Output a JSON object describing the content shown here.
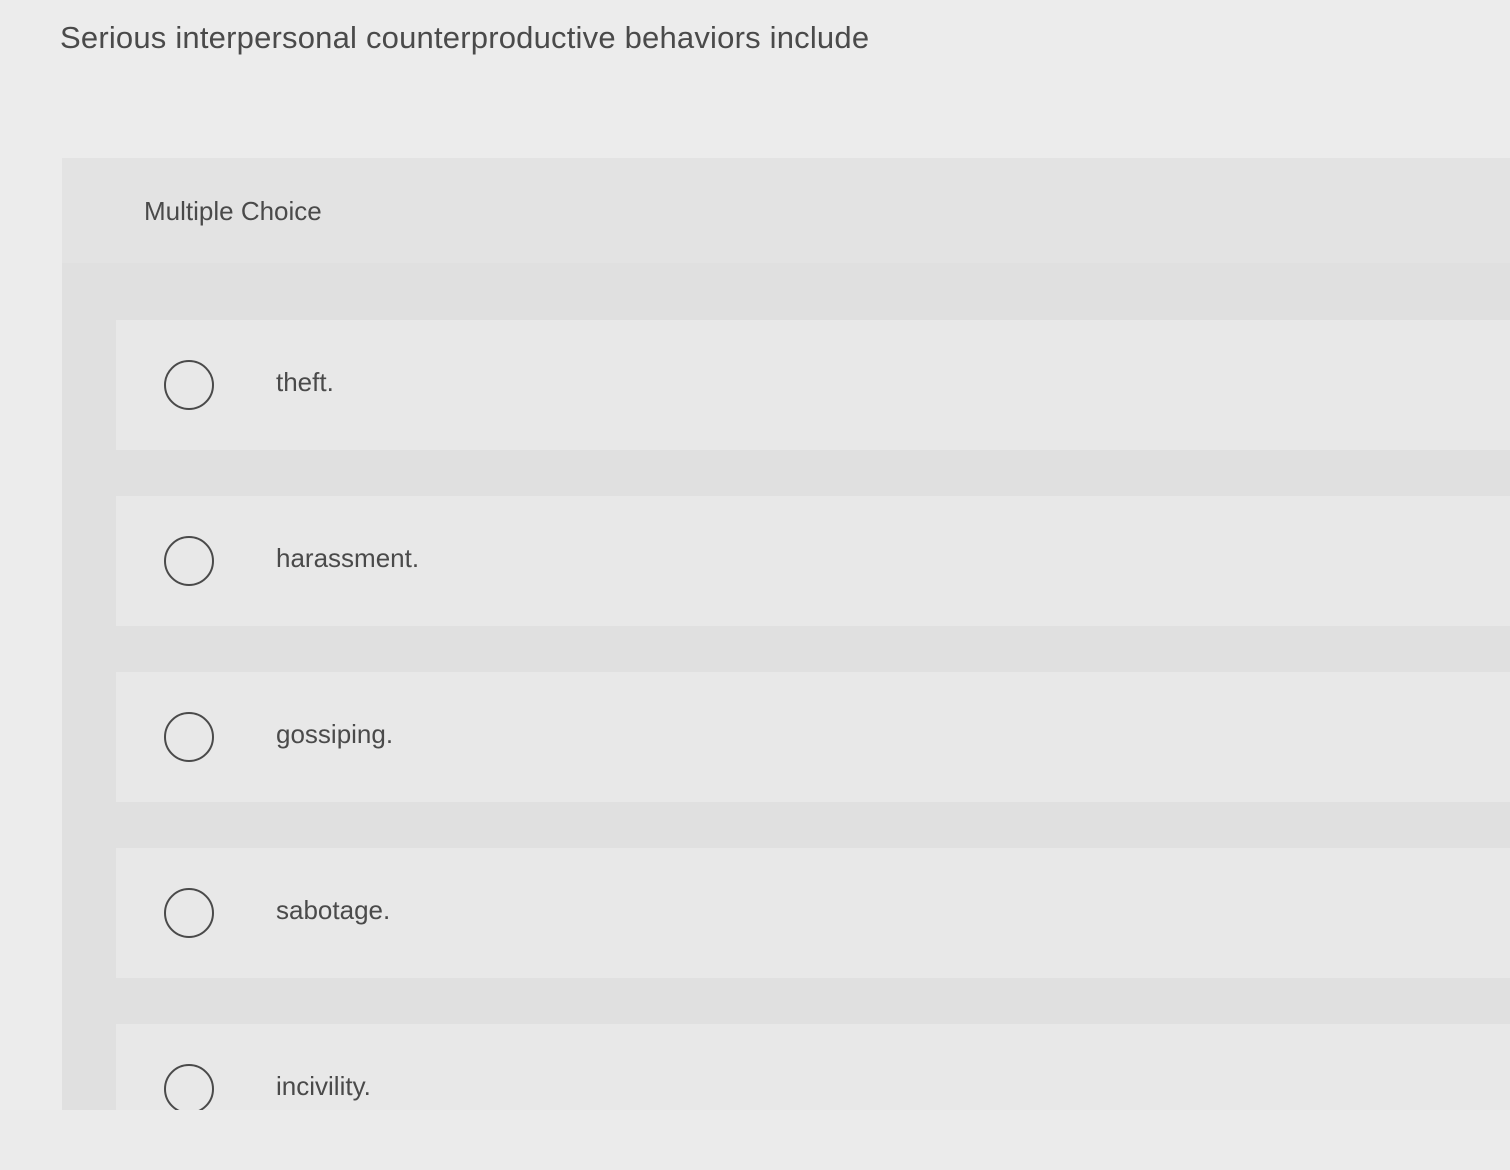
{
  "question": {
    "text": "Serious interpersonal counterproductive behaviors include"
  },
  "panel": {
    "title": "Multiple Choice"
  },
  "options": [
    {
      "label": "theft."
    },
    {
      "label": "harassment."
    },
    {
      "label": "gossiping."
    },
    {
      "label": "sabotage."
    },
    {
      "label": "incivility."
    }
  ],
  "colors": {
    "background": "#ececec",
    "panel": "#e0e0e0",
    "option": "#e8e8e8",
    "text": "#4a4a4a"
  }
}
